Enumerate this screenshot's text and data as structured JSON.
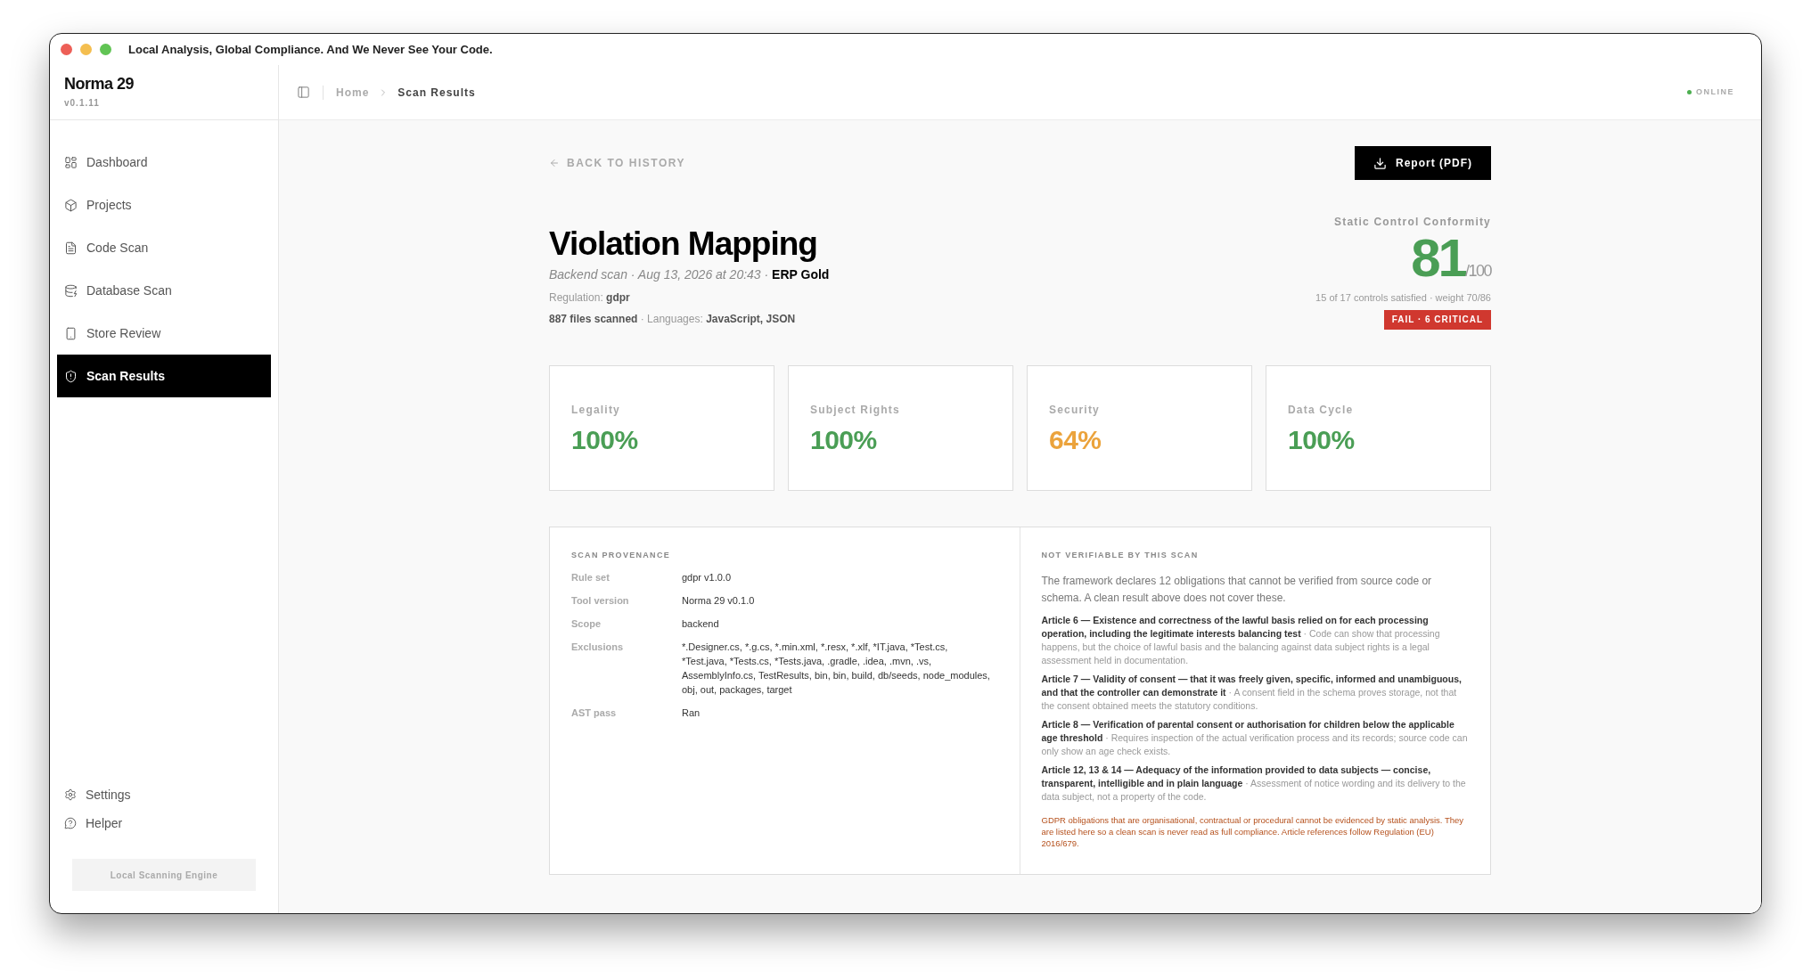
{
  "window": {
    "title": "Local Analysis, Global Compliance. And We Never See Your Code."
  },
  "brand": {
    "name": "Norma 29",
    "version": "v0.1.11"
  },
  "sidebar": {
    "items": [
      {
        "label": "Dashboard",
        "selected": false
      },
      {
        "label": "Projects",
        "selected": false
      },
      {
        "label": "Code Scan",
        "selected": false
      },
      {
        "label": "Database Scan",
        "selected": false
      },
      {
        "label": "Store Review",
        "selected": false
      },
      {
        "label": "Scan Results",
        "selected": true
      }
    ],
    "footer_items": [
      {
        "label": "Settings"
      },
      {
        "label": "Helper"
      }
    ],
    "engine_badge": "Local Scanning Engine"
  },
  "breadcrumb": [
    "Home",
    "Scan Results"
  ],
  "status": {
    "label": "ONLINE",
    "online": true
  },
  "back_link": "BACK TO HISTORY",
  "report_button": "Report (PDF)",
  "title": "Violation Mapping",
  "meta": {
    "scan": "Backend scan · Aug 13, 2026 at 20:43 ·",
    "project": "ERP Gold",
    "regulation_label": "Regulation:",
    "regulation": "gdpr",
    "files": "887 files scanned",
    "languages_label": "· Languages:",
    "languages": "JavaScript, JSON"
  },
  "score": {
    "label": "Static Control Conformity",
    "value": "81",
    "max": "/100",
    "color": "#4a9e55",
    "summary": "15 of 17 controls satisfied · weight 70/86",
    "verdict": "FAIL · 6 CRITICAL"
  },
  "categories": [
    {
      "label": "Legality",
      "value": "100%",
      "color": "#4a9e55"
    },
    {
      "label": "Subject Rights",
      "value": "100%",
      "color": "#4a9e55"
    },
    {
      "label": "Security",
      "value": "64%",
      "color": "#eba33c"
    },
    {
      "label": "Data Cycle",
      "value": "100%",
      "color": "#4a9e55"
    }
  ],
  "provenance": {
    "heading": "SCAN PROVENANCE",
    "rows": [
      {
        "label": "Rule set",
        "value": "gdpr v1.0.0"
      },
      {
        "label": "Tool version",
        "value": "Norma 29 v0.1.0"
      },
      {
        "label": "Scope",
        "value": "backend"
      },
      {
        "label": "Exclusions",
        "value": "*.Designer.cs, *.g.cs, *.min.xml, *.resx, *.xlf, *IT.java, *Test.cs, *Test.java, *Tests.cs, *Tests.java, .gradle, .idea, .mvn, .vs, AssemblyInfo.cs, TestResults, bin, bin, build, db/seeds, node_modules, obj, out, packages, target"
      },
      {
        "label": "AST pass",
        "value": "Ran"
      }
    ]
  },
  "not_verifiable": {
    "heading": "NOT VERIFIABLE BY THIS SCAN",
    "intro": "The framework declares 12 obligations that cannot be verified from source code or schema. A clean result above does not cover these.",
    "items": [
      {
        "title": "Article 6 — Existence and correctness of the lawful basis relied on for each processing operation, including the legitimate interests balancing test",
        "note": "· Code can show that processing happens, but the choice of lawful basis and the balancing against data subject rights is a legal assessment held in documentation."
      },
      {
        "title": "Article 7 — Validity of consent — that it was freely given, specific, informed and unambiguous, and that the controller can demonstrate it",
        "note": "· A consent field in the schema proves storage, not that the consent obtained meets the statutory conditions."
      },
      {
        "title": "Article 8 — Verification of parental consent or authorisation for children below the applicable age threshold",
        "note": "· Requires inspection of the actual verification process and its records; source code can only show an age check exists."
      },
      {
        "title": "Article 12, 13 & 14 — Adequacy of the information provided to data subjects — concise, transparent, intelligible and in plain language",
        "note": "· Assessment of notice wording and its delivery to the data subject, not a property of the code."
      }
    ],
    "disclaimer": "GDPR obligations that are organisational, contractual or procedural cannot be evidenced by static analysis. They are listed here so a clean scan is never read as full compliance. Article references follow Regulation (EU) 2016/679."
  }
}
